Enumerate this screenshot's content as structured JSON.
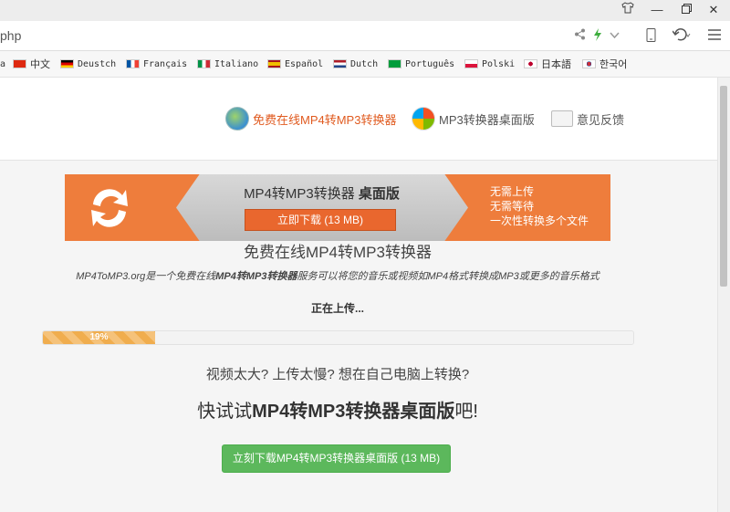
{
  "browser": {
    "url_fragment": "php",
    "window_icons": [
      "shirt-icon",
      "minimize-icon",
      "restore-icon",
      "close-icon"
    ]
  },
  "bookmarks": [
    {
      "label": "a",
      "flag": "none"
    },
    {
      "label": "中文",
      "flag": "china"
    },
    {
      "label": "Deustch",
      "flag": "germany"
    },
    {
      "label": "Français",
      "flag": "france"
    },
    {
      "label": "Italiano",
      "flag": "italy"
    },
    {
      "label": "Español",
      "flag": "spain"
    },
    {
      "label": "Dutch",
      "flag": "netherlands"
    },
    {
      "label": "Português",
      "flag": "brazil"
    },
    {
      "label": "Polski",
      "flag": "poland"
    },
    {
      "label": "日本語",
      "flag": "japan"
    },
    {
      "label": "한국어",
      "flag": "korea"
    }
  ],
  "nav": {
    "online": "免费在线MP4转MP3转换器",
    "desktop": "MP3转换器桌面版",
    "feedback": "意见反馈"
  },
  "banner": {
    "title_prefix": "MP4转MP3转换器",
    "title_bold": "桌面版",
    "button": "立即下载 (13 MB)",
    "line1": "无需上传",
    "line2": "无需等待",
    "line3": "一次性转换多个文件"
  },
  "main": {
    "title": "免费在线MP4转MP3转换器",
    "desc_part1": "MP4ToMP3.org是一个免费在线",
    "desc_bold": "MP4转MP3转换器",
    "desc_part2": "服务可以将您的音乐或视频如MP4格式转换成MP3或更多的音乐格式",
    "status": "正在上传...",
    "progress_label": "19%",
    "progress_value": 0.19,
    "question": "视频太大? 上传太慢? 想在自己电脑上转换?",
    "cta_prefix": "快试试",
    "cta_bold": "MP4转MP3转换器桌面版",
    "cta_suffix": "吧!",
    "download_button": "立刻下载MP4转MP3转换器桌面版 (13 MB)"
  },
  "colors": {
    "banner_orange": "#ee7d3c",
    "accent_orange": "#e05a1f",
    "progress": "#f0ad4e",
    "download_green": "#5cb85c"
  }
}
